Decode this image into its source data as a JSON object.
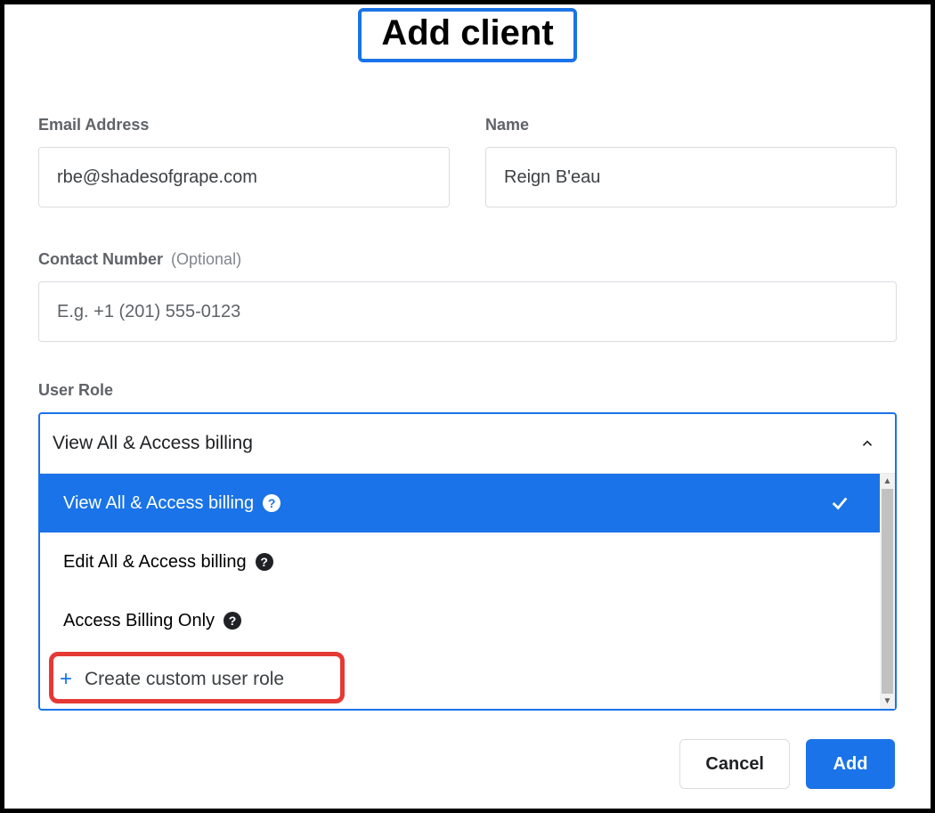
{
  "header": {
    "title": "Add client"
  },
  "fields": {
    "email": {
      "label": "Email Address",
      "value": "rbe@shadesofgrape.com"
    },
    "name": {
      "label": "Name",
      "value": "Reign B'eau"
    },
    "contact": {
      "label": "Contact Number",
      "optional": "(Optional)",
      "placeholder": "E.g. +1 (201) 555-0123"
    }
  },
  "role": {
    "label": "User Role",
    "selected": "View All & Access billing",
    "options": [
      "View All & Access billing",
      "Edit All & Access billing",
      "Access Billing Only"
    ],
    "create": "Create custom user role"
  },
  "footer": {
    "cancel": "Cancel",
    "add": "Add"
  }
}
